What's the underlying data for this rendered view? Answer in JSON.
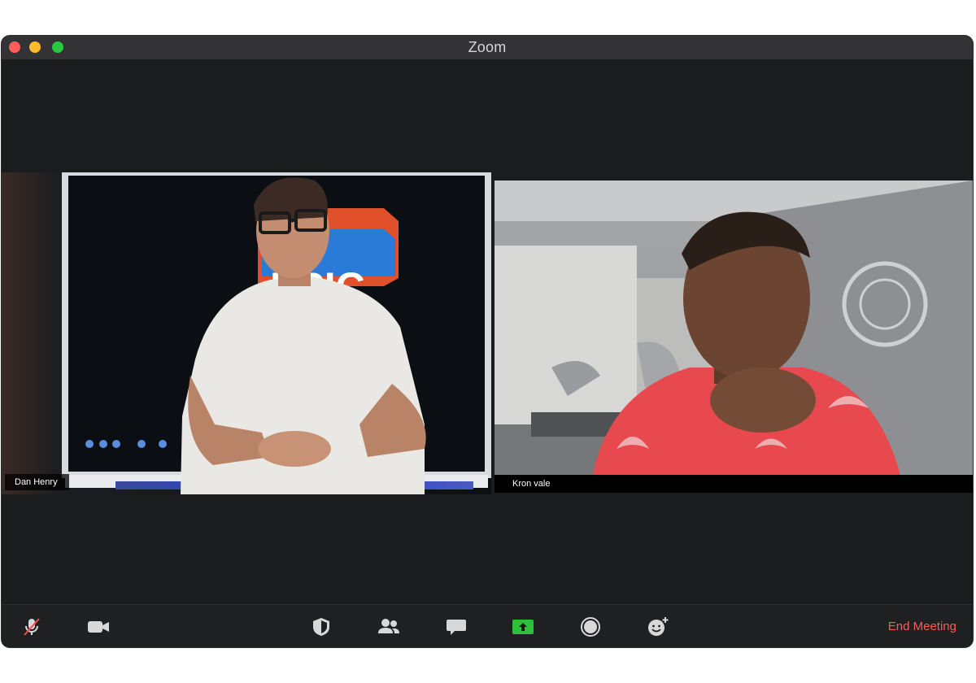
{
  "window": {
    "title": "Zoom"
  },
  "participants": [
    {
      "name": "Dan Henry",
      "active_speaker": true
    },
    {
      "name": "Kron vale",
      "active_speaker": false
    }
  ],
  "toolbar": {
    "icons": [
      "microphone-muted-icon",
      "video-camera-icon",
      "security-shield-icon",
      "participants-icon",
      "chat-icon",
      "share-screen-icon",
      "record-icon",
      "reactions-icon"
    ],
    "end_meeting_label": "End Meeting"
  },
  "colors": {
    "active_speaker_border": "#24d24a",
    "end_meeting": "#ff5a5a",
    "share_screen": "#2fbf3a",
    "mute_slash": "#ff4a4a"
  }
}
